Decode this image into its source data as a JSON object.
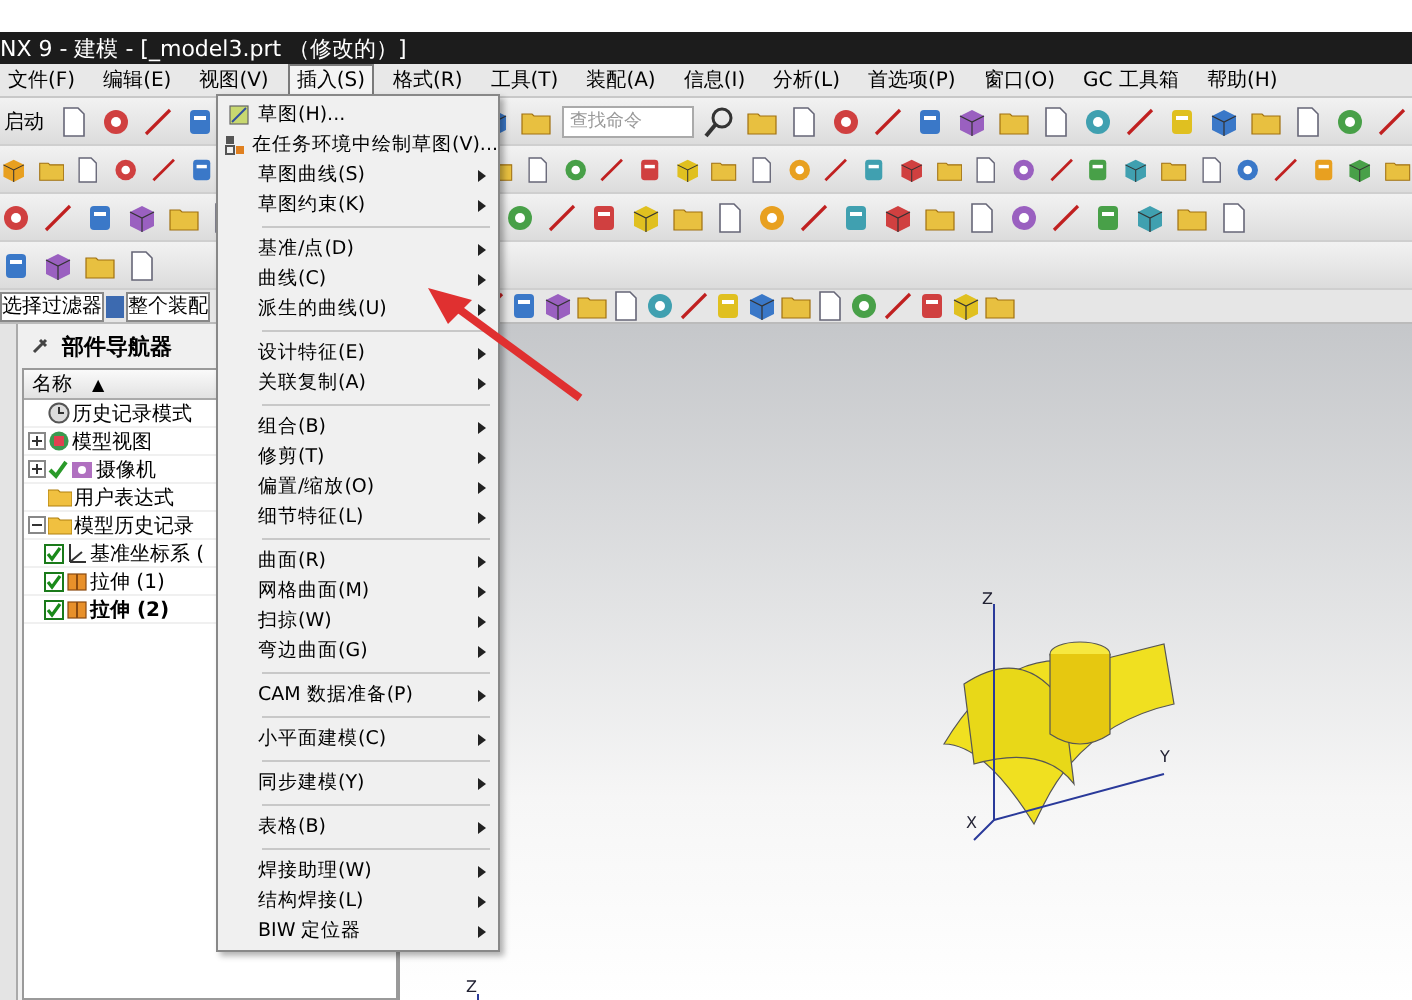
{
  "window": {
    "title": "NX 9 - 建模 - [_model3.prt （修改的）]"
  },
  "menubar": [
    {
      "label": "文件(F)",
      "selected": false
    },
    {
      "label": "编辑(E)",
      "selected": false
    },
    {
      "label": "视图(V)",
      "selected": false
    },
    {
      "label": "插入(S)",
      "selected": true
    },
    {
      "label": "格式(R)",
      "selected": false
    },
    {
      "label": "工具(T)",
      "selected": false
    },
    {
      "label": "装配(A)",
      "selected": false
    },
    {
      "label": "信息(I)",
      "selected": false
    },
    {
      "label": "分析(L)",
      "selected": false
    },
    {
      "label": "首选项(P)",
      "selected": false
    },
    {
      "label": "窗口(O)",
      "selected": false
    },
    {
      "label": "GC 工具箱",
      "selected": false
    },
    {
      "label": "帮助(H)",
      "selected": false
    }
  ],
  "toolbar": {
    "start_button": "启动",
    "search": {
      "placeholder": "查找命令"
    }
  },
  "filter_bar": {
    "type_filter": "选择过滤器",
    "scope": "整个装配"
  },
  "insert_menu": {
    "groups": [
      [
        {
          "label": "草图(H)...",
          "submenu": false
        },
        {
          "label": "在任务环境中绘制草图(V)...",
          "submenu": false
        },
        {
          "label": "草图曲线(S)",
          "submenu": true
        },
        {
          "label": "草图约束(K)",
          "submenu": true
        }
      ],
      [
        {
          "label": "基准/点(D)",
          "submenu": true
        },
        {
          "label": "曲线(C)",
          "submenu": true
        },
        {
          "label": "派生的曲线(U)",
          "submenu": true
        }
      ],
      [
        {
          "label": "设计特征(E)",
          "submenu": true
        },
        {
          "label": "关联复制(A)",
          "submenu": true
        }
      ],
      [
        {
          "label": "组合(B)",
          "submenu": true
        },
        {
          "label": "修剪(T)",
          "submenu": true
        },
        {
          "label": "偏置/缩放(O)",
          "submenu": true
        },
        {
          "label": "细节特征(L)",
          "submenu": true
        }
      ],
      [
        {
          "label": "曲面(R)",
          "submenu": true
        },
        {
          "label": "网格曲面(M)",
          "submenu": true
        },
        {
          "label": "扫掠(W)",
          "submenu": true
        },
        {
          "label": "弯边曲面(G)",
          "submenu": true
        }
      ],
      [
        {
          "label": "CAM 数据准备(P)",
          "submenu": true
        }
      ],
      [
        {
          "label": "小平面建模(C)",
          "submenu": true
        }
      ],
      [
        {
          "label": "同步建模(Y)",
          "submenu": true
        }
      ],
      [
        {
          "label": "表格(B)",
          "submenu": true
        }
      ],
      [
        {
          "label": "焊接助理(W)",
          "submenu": true
        },
        {
          "label": "结构焊接(L)",
          "submenu": true
        },
        {
          "label": "BIW 定位器",
          "submenu": true
        }
      ]
    ]
  },
  "navigator": {
    "title": "部件导航器",
    "column": "名称",
    "sort_mark": "▲",
    "tree": [
      {
        "label": "历史记录模式",
        "kind": "clock",
        "bold": false
      },
      {
        "label": "模型视图",
        "kind": "views",
        "expanded": false,
        "bold": false
      },
      {
        "label": "摄像机",
        "kind": "camera",
        "expanded": false,
        "checked": true,
        "bold": false
      },
      {
        "label": "用户表达式",
        "kind": "folder",
        "bold": false
      },
      {
        "label": "模型历史记录",
        "kind": "folder",
        "expanded": true,
        "bold": false,
        "children": [
          {
            "label": "基准坐标系 (",
            "kind": "csys",
            "checked": true,
            "bold": false
          },
          {
            "label": "拉伸 (1)",
            "kind": "feature",
            "checked": true,
            "bold": false
          },
          {
            "label": "拉伸 (2)",
            "kind": "feature",
            "checked": true,
            "bold": true
          }
        ]
      }
    ]
  },
  "viewport": {
    "axes": {
      "z": "Z",
      "x": "X",
      "y": "Y"
    },
    "small_triad": "Z"
  }
}
